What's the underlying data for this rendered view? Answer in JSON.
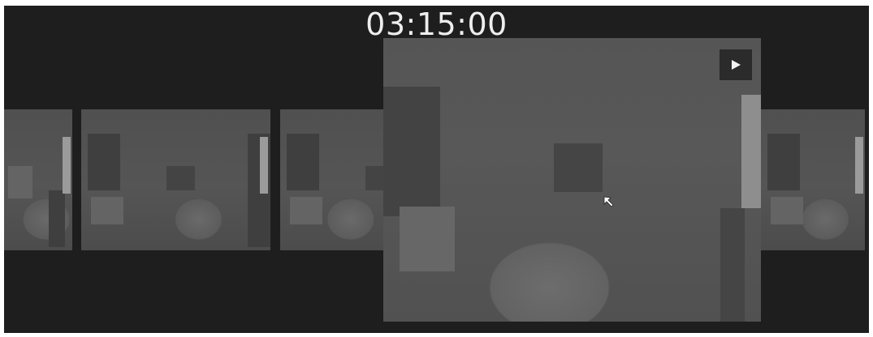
{
  "player": {
    "timestamp": "03:15:00",
    "current_frame": 4,
    "frame_count": 5
  },
  "controls": {
    "play_icon": "play-icon",
    "pointer_icon": "mouse-pointer-icon"
  },
  "colors": {
    "background": "#1e1e1e",
    "timestamp_text": "#eeeeee",
    "marker": "#9b9b9b"
  }
}
